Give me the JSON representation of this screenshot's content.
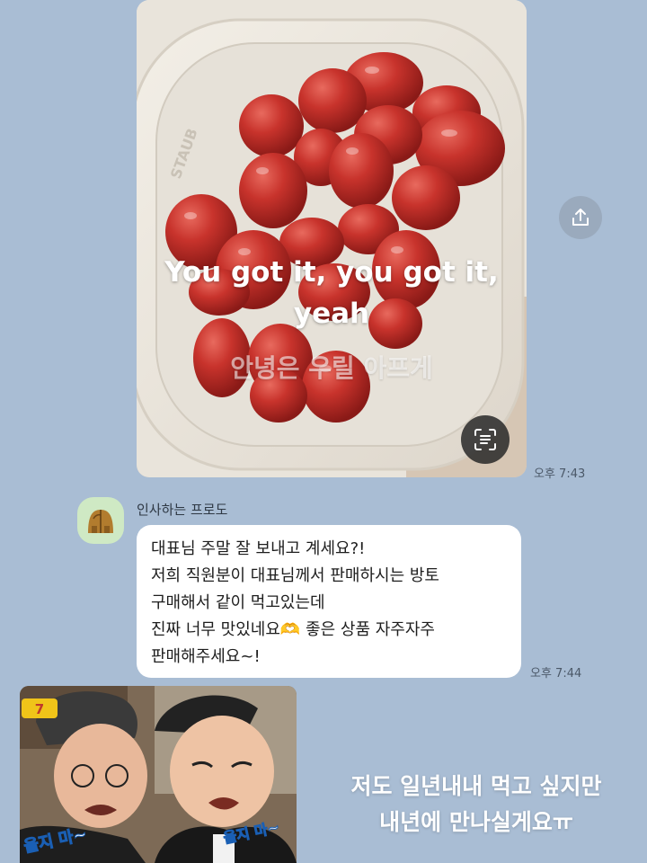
{
  "photo_message": {
    "caption_en": "You got it, you got it, yeah",
    "caption_ko": "안녕은 우릴 아프게",
    "time": "오후 7:43",
    "bowl_brand": "STAUB"
  },
  "share_button": {
    "icon": "share-icon"
  },
  "scan_button": {
    "icon": "scan-text-icon"
  },
  "message": {
    "sender": "인사하는 프로도",
    "lines": [
      "대표님 주말 잘 보내고 계세요?!",
      "저희 직원분이 대표님께서 판매하시는 방토",
      "구매해서 같이 먹고있는데",
      "진짜 너무 맛있네요🫶 좋은 상품 자주자주",
      "판매해주세요~!"
    ],
    "time": "오후 7:44"
  },
  "meme": {
    "left_caption": "울지 마~",
    "right_caption": "울지 마~",
    "channel_logo": "7"
  },
  "overlay_text": {
    "line1": "저도 일년내내 먹고 싶지만",
    "line2": "내년에 만나실게요ㅠ"
  },
  "colors": {
    "background": "#a9bdd4",
    "bubble": "#ffffff",
    "tomato": "#c6302b",
    "avatar_bg": "#cfe9c4"
  }
}
